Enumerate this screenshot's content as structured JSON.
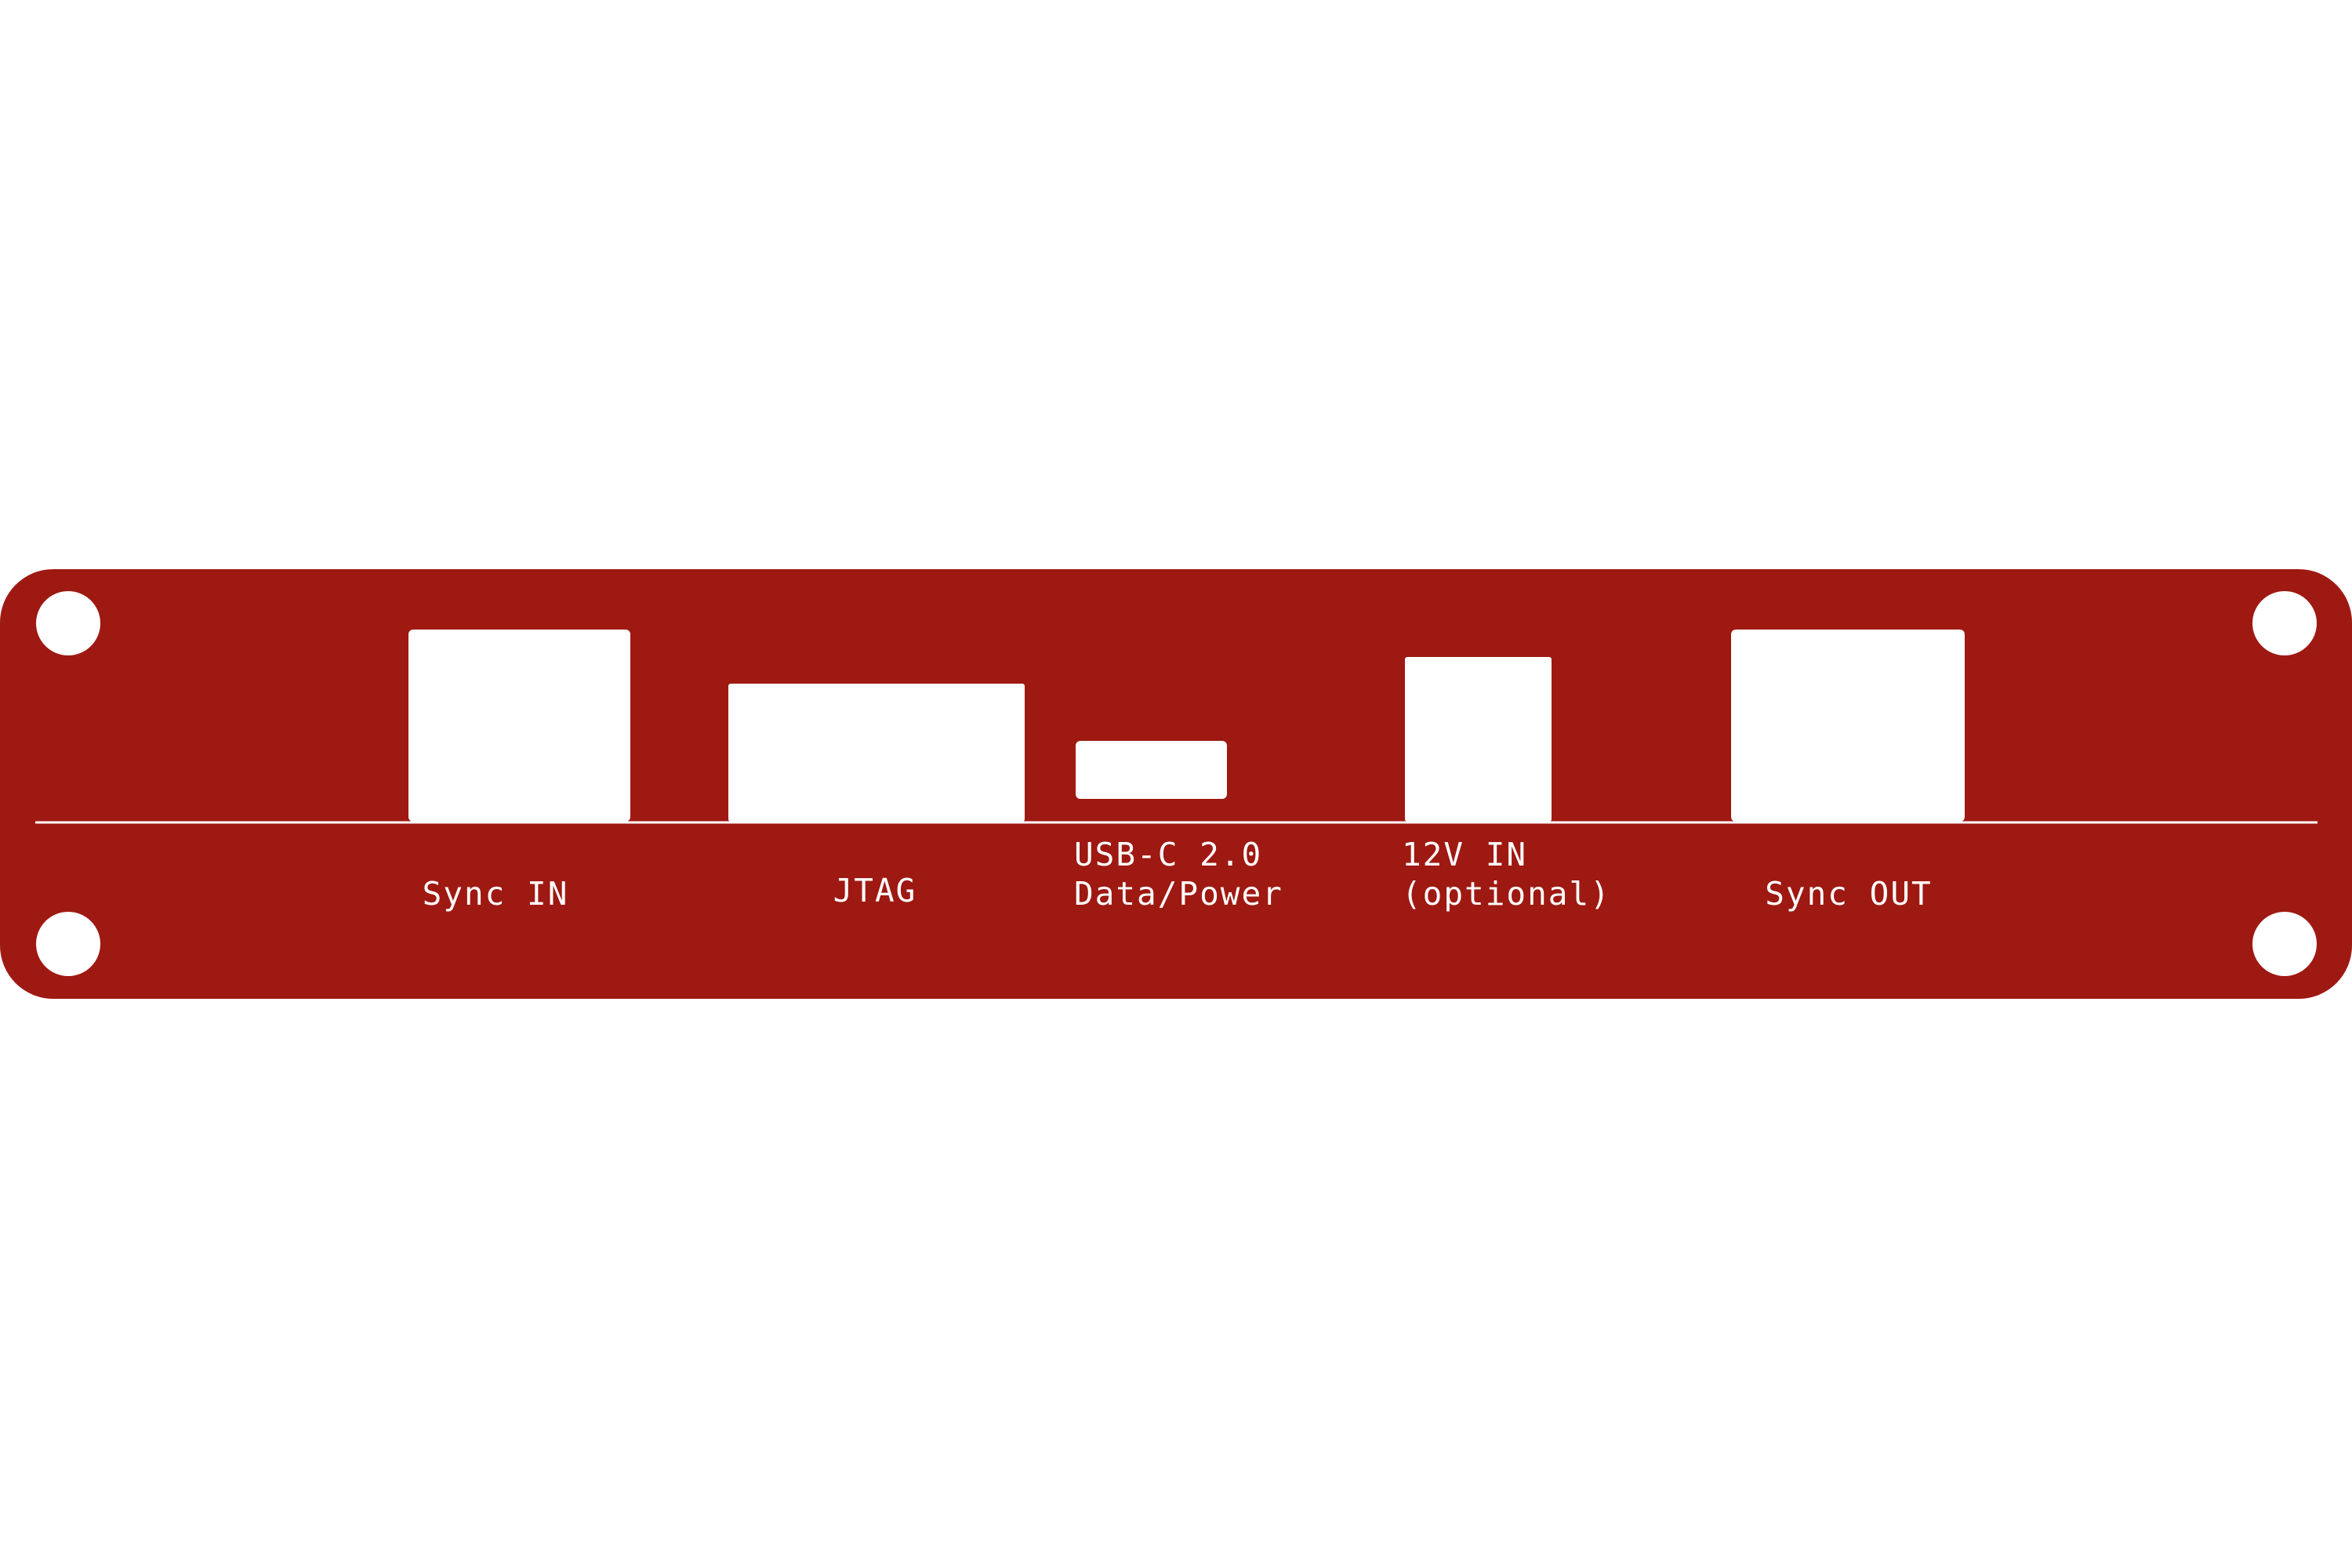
{
  "panel": {
    "color": "#9E1912",
    "cutout_color": "#ffffff",
    "labels": {
      "sync_in": "Sync IN",
      "jtag": "JTAG",
      "usb_c_line1": "USB-C 2.0",
      "usb_c_line2": "Data/Power",
      "power_line1": "12V IN",
      "power_line2": "(optional)",
      "sync_out": "Sync OUT"
    }
  }
}
